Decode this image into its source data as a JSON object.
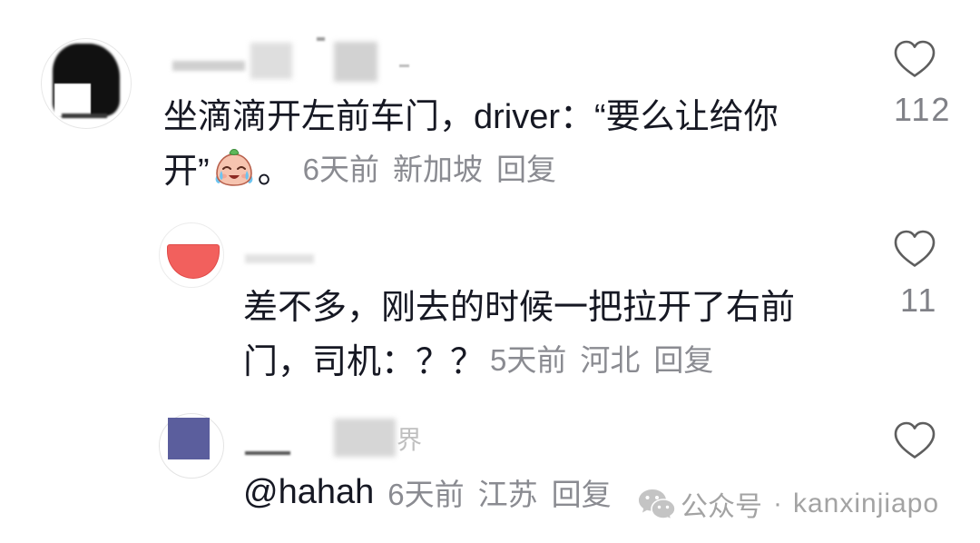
{
  "thread": {
    "comment": {
      "text_line1": "坐滴滴开左前车门，driver：“要么让给你",
      "text_line2_before_emoji": "开”",
      "emoji_icon": "crying-emoji-icon",
      "text_line2_after_emoji": "。",
      "time": "6天前",
      "location": "新加坡",
      "reply_label": "回复",
      "like_icon": "heart-icon",
      "likes": "112"
    },
    "replies": [
      {
        "text_line1": "差不多，刚去的时候一把拉开了右前",
        "text_line2": "门，司机：？？",
        "time": "5天前",
        "location": "河北",
        "reply_label": "回复",
        "like_icon": "heart-icon",
        "likes": "11"
      },
      {
        "username_visible_fragment": "界",
        "mention": "@hahah",
        "time": "6天前",
        "location": "江苏",
        "reply_label": "回复",
        "like_icon": "heart-icon"
      }
    ]
  },
  "watermark": {
    "icon": "wechat-icon",
    "label": "公众号",
    "separator": "·",
    "account": "kanxinjiapo"
  },
  "colors": {
    "text": "#161823",
    "meta": "#8a8b91",
    "count": "#808187",
    "icon": "#5e5e5e",
    "watermark": "#a3a3a3"
  }
}
